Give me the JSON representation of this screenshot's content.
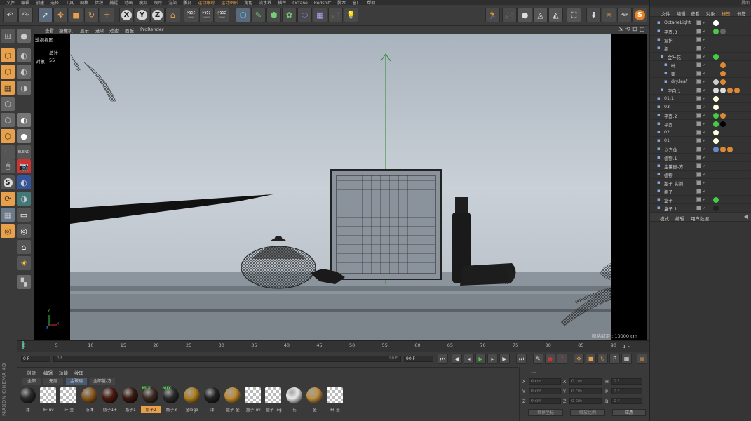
{
  "menubar": [
    "文件",
    "编辑",
    "创建",
    "选择",
    "工具",
    "网格",
    "体积",
    "捕捉",
    "动画",
    "模拟",
    "跟踪",
    "渲染",
    "雕刻",
    "运动跟踪",
    "运动图形",
    "角色",
    "流水线",
    "插件",
    "Octane",
    "Redshift",
    "脚本",
    "窗口",
    "帮助"
  ],
  "menubar_extra": "界面",
  "viewport_menu": [
    "查看",
    "摄像机",
    "显示",
    "选项",
    "过滤",
    "面板",
    "ProRender"
  ],
  "viewport": {
    "view_name": "透视视图",
    "hud_total_label": "总计",
    "hud_object_label": "对象",
    "hud_object_count": "55",
    "grid_spacing": "网格间距 : 10000 cm",
    "axis_y": "Y",
    "axis_x": "X",
    "axis_z": "Z"
  },
  "timeline": {
    "ticks": [
      "0",
      "5",
      "10",
      "15",
      "20",
      "25",
      "30",
      "35",
      "40",
      "45",
      "50",
      "55",
      "60",
      "65",
      "70",
      "75",
      "80",
      "85",
      "90"
    ],
    "end_frame": "-1 F"
  },
  "transport": {
    "current_frame": "0 F",
    "range_start": "0 F",
    "range_end": "90 F",
    "end_frame": "90 F"
  },
  "materials": {
    "menu": [
      "创建",
      "编辑",
      "功能",
      "纹理"
    ],
    "filters": [
      "全部",
      "无层",
      "金玻璃",
      "全部盖-方"
    ],
    "items": [
      {
        "label": "漆",
        "color": "#2a2a2a"
      },
      {
        "label": "纤-uv",
        "color": "checker"
      },
      {
        "label": "纤-金",
        "color": "checker"
      },
      {
        "label": "液体",
        "color": "#8a5a20"
      },
      {
        "label": "瓶子1+",
        "color": "#4a1a10"
      },
      {
        "label": "瓶子1",
        "color": "#3a1a10"
      },
      {
        "label": "瓶子2",
        "color": "#3a2a20",
        "badge": "MIX",
        "selected": true
      },
      {
        "label": "瓶子3",
        "color": "#2a2a2a",
        "badge": "MIX"
      },
      {
        "label": "金logo",
        "color": "#b08020"
      },
      {
        "label": "漆",
        "color": "#222"
      },
      {
        "label": "盒子-金",
        "color": "#c08a30"
      },
      {
        "label": "盒子-uv",
        "color": "checker"
      },
      {
        "label": "盒子-log",
        "color": "checker"
      },
      {
        "label": "花",
        "color": "#e8e8e8"
      },
      {
        "label": "金",
        "color": "#c09040"
      },
      {
        "label": "纤-金",
        "color": "checker"
      }
    ]
  },
  "maxon": "MAXON CINEMA 4D",
  "coords": {
    "rows": [
      [
        "X",
        "0 cm",
        "X",
        "0 cm",
        "H",
        "0 °"
      ],
      [
        "Y",
        "0 cm",
        "Y",
        "0 cm",
        "P",
        "0 °"
      ],
      [
        "Z",
        "0 cm",
        "Z",
        "0 cm",
        "B",
        "0 °"
      ]
    ],
    "world_label": "世界坐标",
    "scale_label": "缩放比例",
    "apply_label": "应用",
    "header": "---"
  },
  "objmgr": {
    "tabs": [
      "文件",
      "编辑",
      "查看",
      "对象",
      "标签",
      "书签"
    ],
    "rows": [
      {
        "name": "OctaneLight",
        "indent": 0
      },
      {
        "name": "平面.3",
        "indent": 0
      },
      {
        "name": "摄护",
        "indent": 0
      },
      {
        "name": "瓶",
        "indent": 0
      },
      {
        "name": "金叶花",
        "indent": 1
      },
      {
        "name": "叶",
        "indent": 2
      },
      {
        "name": "瓣",
        "indent": 2
      },
      {
        "name": "dry.leaf",
        "indent": 2
      },
      {
        "name": "空白.1",
        "indent": 1
      },
      {
        "name": "01.1",
        "indent": 0
      },
      {
        "name": "03",
        "indent": 0
      },
      {
        "name": "平面.2",
        "indent": 0
      },
      {
        "name": "平面",
        "indent": 0
      },
      {
        "name": "02",
        "indent": 0
      },
      {
        "name": "01",
        "indent": 0
      },
      {
        "name": "立方体",
        "indent": 0
      },
      {
        "name": "植物.1",
        "indent": 0
      },
      {
        "name": "金镶嵌-方",
        "indent": 0
      },
      {
        "name": "植物",
        "indent": 0
      },
      {
        "name": "瓶子 实例",
        "indent": 0
      },
      {
        "name": "瓶子",
        "indent": 0
      },
      {
        "name": "盒子",
        "indent": 0
      },
      {
        "name": "盒子.1",
        "indent": 0
      }
    ]
  },
  "attrmgr": {
    "tabs": [
      "模式",
      "编辑",
      "用户数据"
    ]
  },
  "colors": {
    "accent": "#e8a04a",
    "viewport_bg": "#c4cbd2",
    "selection": "#5a6a7a"
  }
}
